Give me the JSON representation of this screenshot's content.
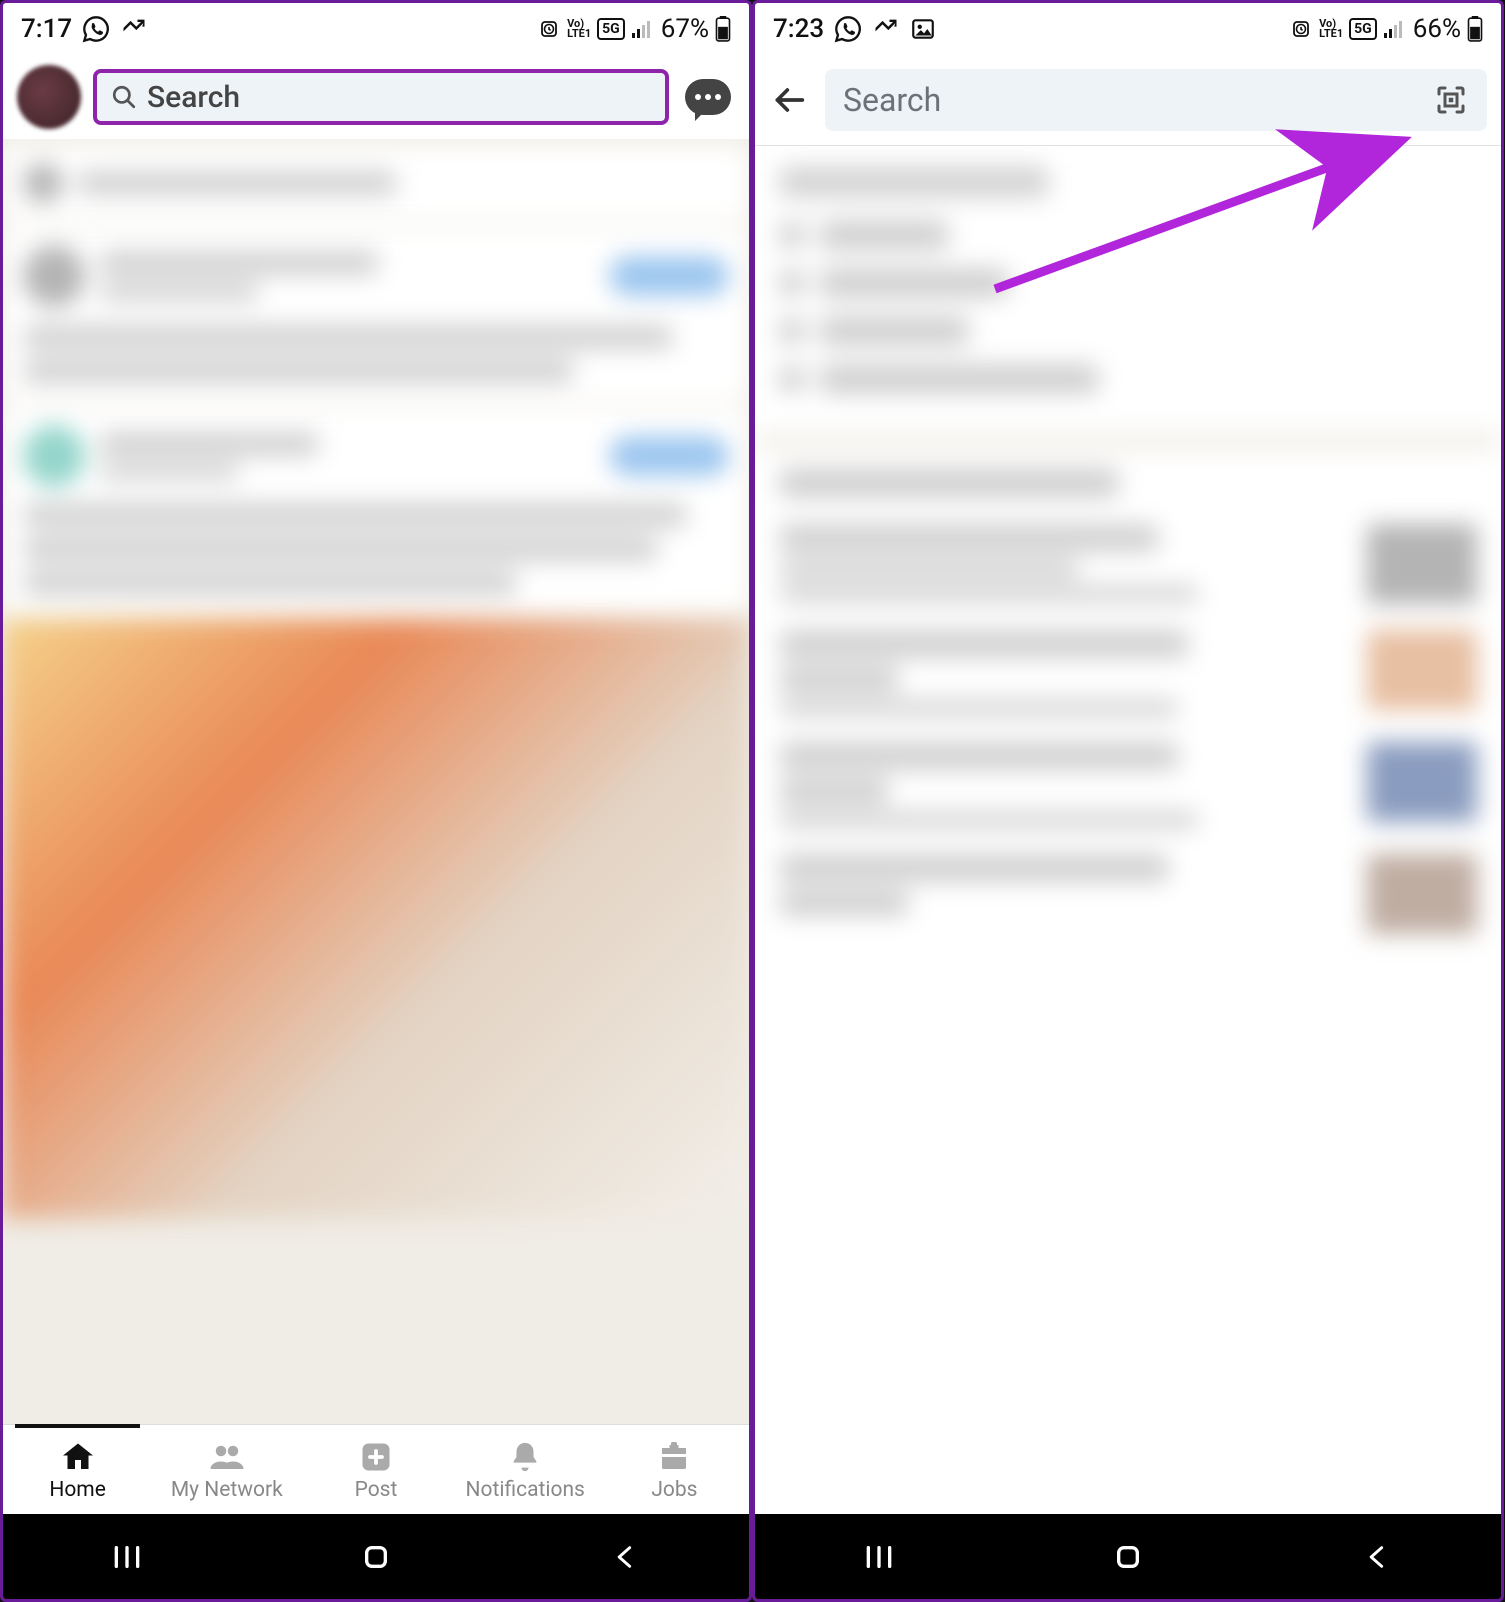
{
  "left_phone": {
    "status": {
      "time": "7:17",
      "battery_pct": "67%",
      "icons": [
        "whatsapp",
        "missed-call",
        "alarm",
        "volte",
        "5g",
        "signal",
        "battery"
      ]
    },
    "header": {
      "search_placeholder": "Search"
    },
    "bottom_nav": {
      "items": [
        {
          "label": "Home",
          "icon": "home-icon",
          "active": true
        },
        {
          "label": "My Network",
          "icon": "people-icon",
          "active": false
        },
        {
          "label": "Post",
          "icon": "plus-box-icon",
          "active": false
        },
        {
          "label": "Notifications",
          "icon": "bell-icon",
          "active": false
        },
        {
          "label": "Jobs",
          "icon": "briefcase-icon",
          "active": false
        }
      ]
    }
  },
  "right_phone": {
    "status": {
      "time": "7:23",
      "battery_pct": "66%",
      "icons": [
        "whatsapp",
        "missed-call",
        "image",
        "alarm",
        "volte",
        "5g",
        "signal",
        "battery"
      ]
    },
    "header": {
      "search_placeholder": "Search"
    }
  },
  "colors": {
    "highlight": "#8E24AA",
    "arrow": "#B226DB"
  }
}
